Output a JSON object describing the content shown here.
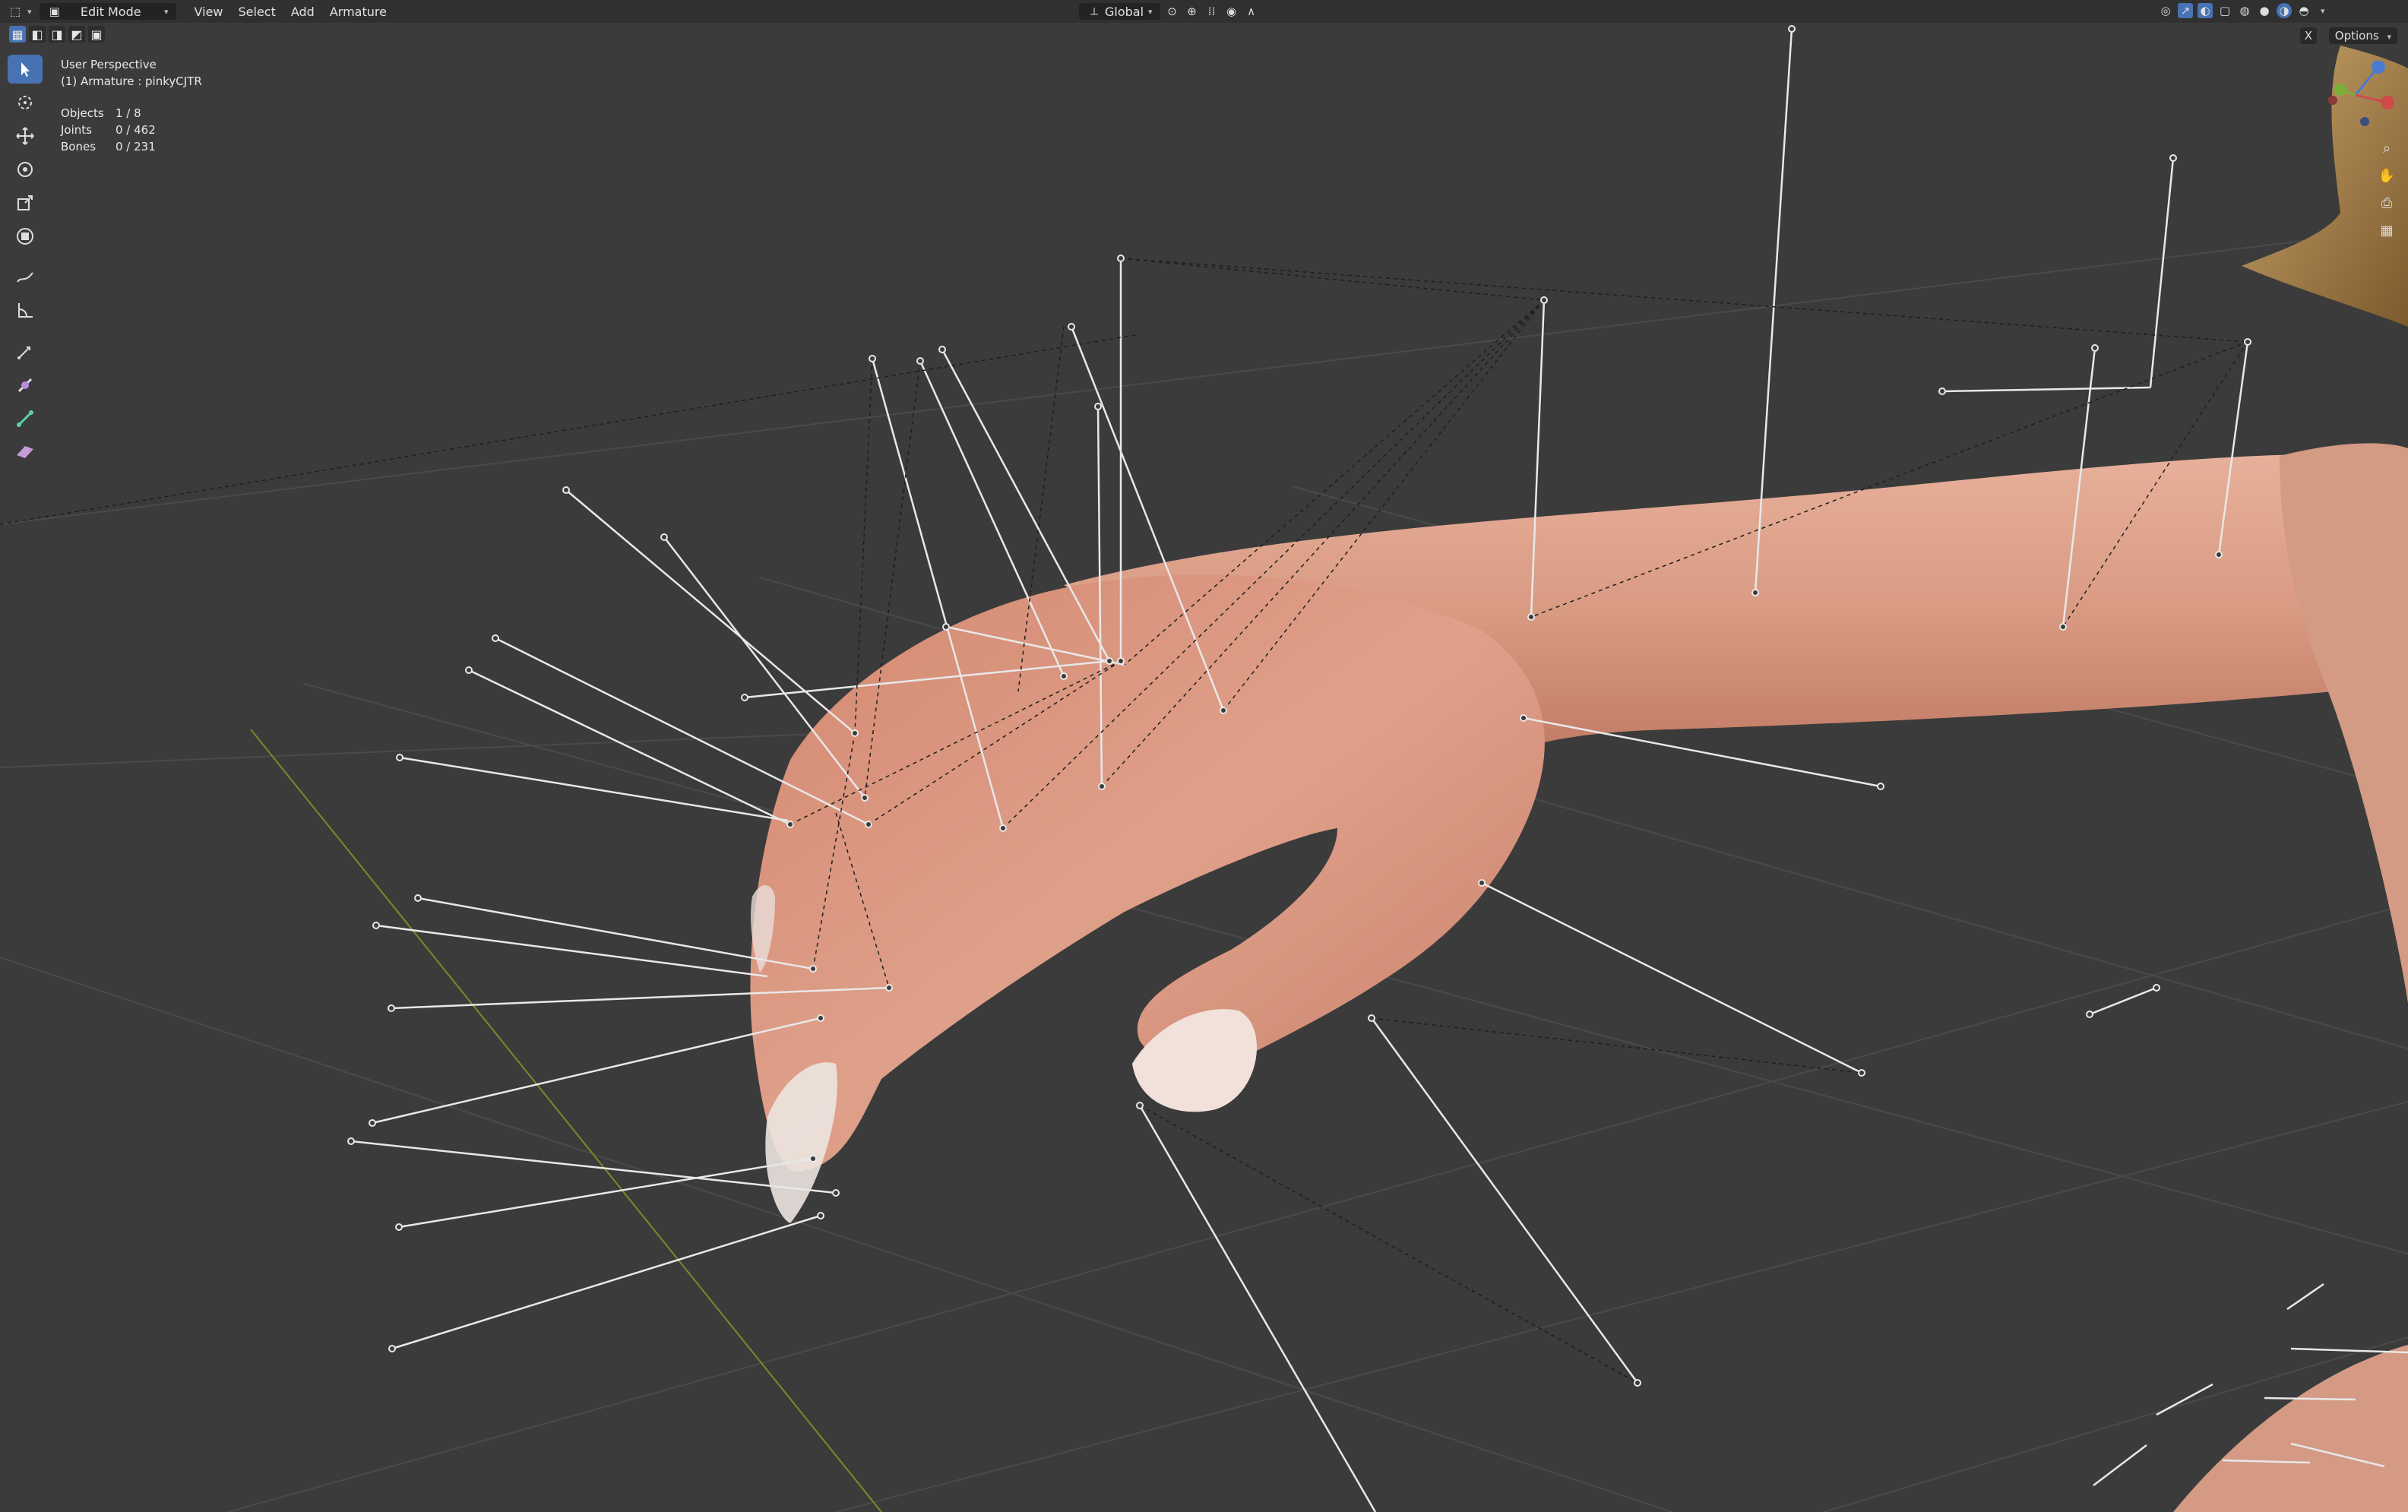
{
  "header": {
    "mode": "Edit Mode",
    "menus": [
      "View",
      "Select",
      "Add",
      "Armature"
    ],
    "transform_orientation": "Global",
    "options_label": "Options",
    "x_label": "X"
  },
  "viewport": {
    "view_name": "User Perspective",
    "object_label": "(1) Armature : pinkyCJTR",
    "stats": [
      {
        "label": "Objects",
        "value": "1 / 8"
      },
      {
        "label": "Joints",
        "value": "0 / 462"
      },
      {
        "label": "Bones",
        "value": "0 / 231"
      }
    ]
  },
  "toolbar": {
    "tools": [
      "select-box",
      "cursor",
      "move",
      "rotate",
      "scale",
      "transform",
      "annotate",
      "measure",
      "extrude",
      "roll",
      "bone-size",
      "bone-envelope"
    ]
  },
  "colors": {
    "viewport_bg": "#3b3b3b",
    "header_bg": "#2a2a2a",
    "accent": "#4772b3",
    "skin": "#d89880",
    "bone_line": "#e8e8e8"
  }
}
